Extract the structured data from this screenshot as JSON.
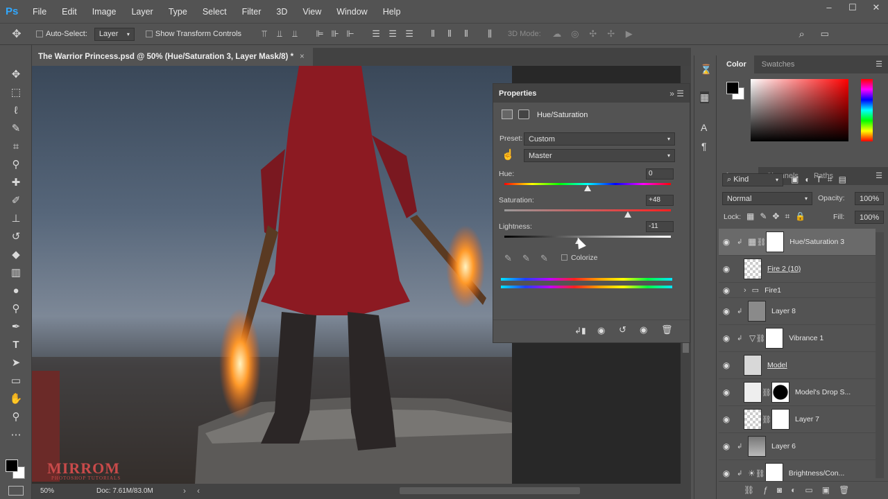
{
  "app": {
    "logo": "Ps"
  },
  "menu": [
    "File",
    "Edit",
    "Image",
    "Layer",
    "Type",
    "Select",
    "Filter",
    "3D",
    "View",
    "Window",
    "Help"
  ],
  "window_controls": [
    "–",
    "☐",
    "✕"
  ],
  "options": {
    "auto_select": "Auto-Select:",
    "auto_select_target": "Layer",
    "show_transform": "Show Transform Controls",
    "mode_3d": "3D Mode:"
  },
  "document": {
    "tab_title": "The Warrior Princess.psd @ 50% (Hue/Saturation 3, Layer Mask/8) *",
    "close": "×"
  },
  "status": {
    "zoom": "50%",
    "doc": "Doc: 7.61M/83.0M"
  },
  "watermark": {
    "name": "MIRROM",
    "sub": "PHOTOSHOP TUTORIALS"
  },
  "properties": {
    "tab": "Properties",
    "adjustment": "Hue/Saturation",
    "preset_label": "Preset:",
    "preset_value": "Custom",
    "channel_value": "Master",
    "hue_label": "Hue:",
    "hue_value": "0",
    "hue": 0,
    "sat_label": "Saturation:",
    "sat_value": "+48",
    "saturation": 48,
    "light_label": "Lightness:",
    "light_value": "-11",
    "lightness": -11,
    "colorize": "Colorize"
  },
  "color_panel": {
    "tabs": [
      "Color",
      "Swatches"
    ],
    "fg": "#000000",
    "bg": "#ffffff"
  },
  "layers_panel": {
    "tabs": [
      "Layers",
      "Channels",
      "Paths"
    ],
    "kind": "Kind",
    "blend": "Normal",
    "opacity_label": "Opacity:",
    "opacity": "100%",
    "lock_label": "Lock:",
    "fill_label": "Fill:",
    "fill": "100%",
    "layers": [
      {
        "name": "Hue/Saturation 3",
        "type": "adjust"
      },
      {
        "name": "Fire 2 (10)",
        "type": "smart"
      },
      {
        "name": "Fire1",
        "type": "group"
      },
      {
        "name": "Layer 8",
        "type": "pixel"
      },
      {
        "name": "Vibrance 1",
        "type": "adjust"
      },
      {
        "name": "Model",
        "type": "pixel"
      },
      {
        "name": "Model's Drop S...",
        "type": "masked"
      },
      {
        "name": "Layer 7",
        "type": "masked"
      },
      {
        "name": "Layer 6",
        "type": "pixel"
      },
      {
        "name": "Brightness/Con...",
        "type": "adjust"
      }
    ]
  }
}
